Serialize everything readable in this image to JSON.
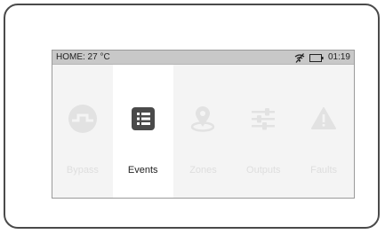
{
  "status_bar": {
    "location_temp": "HOME: 27 °C",
    "time": "01:19",
    "signal_icon": "wifi-off-icon",
    "battery_icon": "battery-icon"
  },
  "menu": {
    "items": [
      {
        "label": "Bypass",
        "icon": "bypass-icon",
        "active": false
      },
      {
        "label": "Events",
        "icon": "events-list-icon",
        "active": true
      },
      {
        "label": "Zones",
        "icon": "zones-location-icon",
        "active": false
      },
      {
        "label": "Outputs",
        "icon": "outputs-sliders-icon",
        "active": false
      },
      {
        "label": "Faults",
        "icon": "faults-warning-icon",
        "active": false
      }
    ]
  },
  "colors": {
    "active_icon": "#4a4a4a",
    "inactive_icon": "#e2e2e2",
    "status_bar_bg": "#c8c8c8"
  }
}
